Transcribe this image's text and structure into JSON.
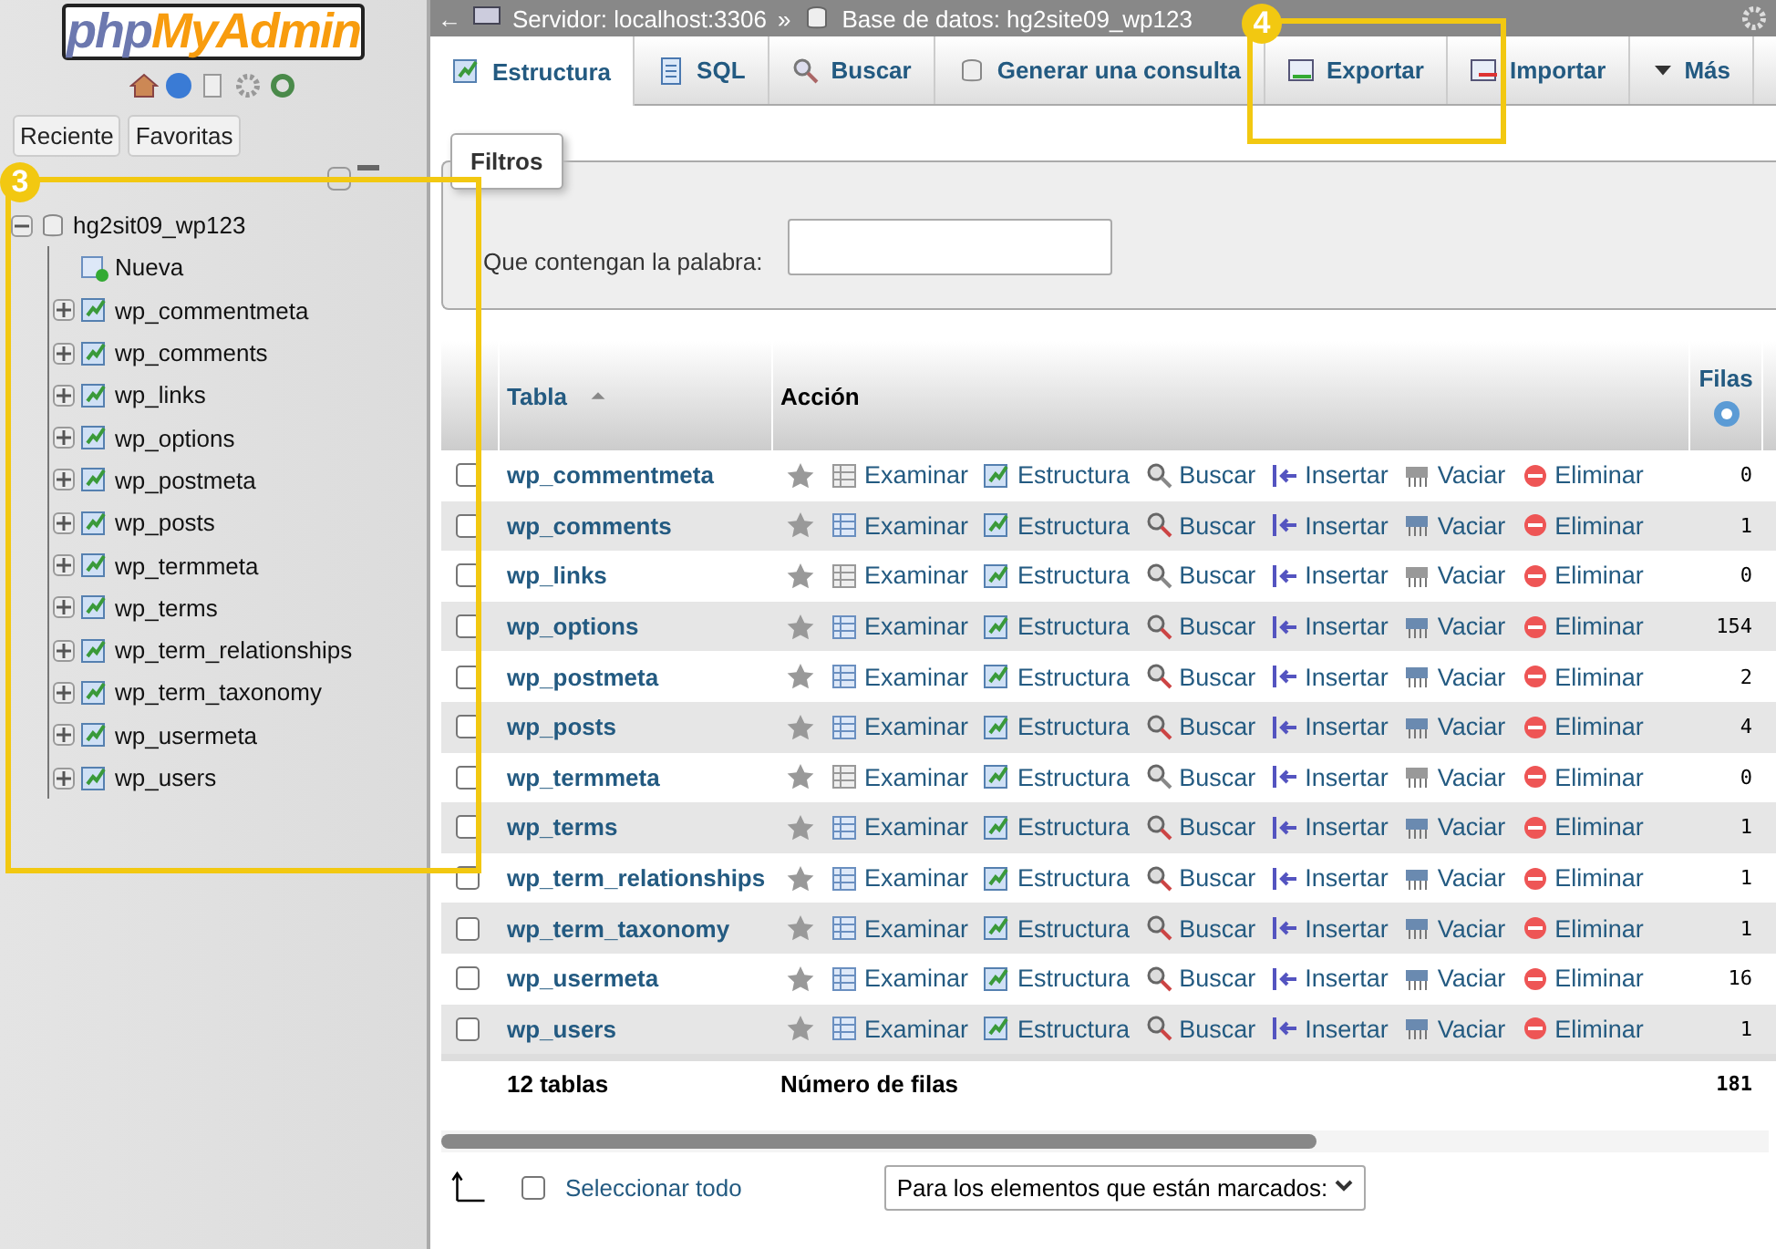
{
  "sidebar": {
    "logo": {
      "part1": "php",
      "part2": "MyAdmin"
    },
    "buttons": [
      "Reciente",
      "Favoritas"
    ],
    "tree": [
      {
        "label": "hg2sit09_wp123",
        "kind": "database",
        "expanded": true,
        "children": [
          {
            "label": "Nueva",
            "kind": "new"
          },
          {
            "label": "wp_commentmeta",
            "kind": "table",
            "expanded": false
          },
          {
            "label": "wp_comments",
            "kind": "table",
            "expanded": false
          },
          {
            "label": "wp_links",
            "kind": "table",
            "expanded": false
          },
          {
            "label": "wp_options",
            "kind": "table",
            "expanded": false
          },
          {
            "label": "wp_postmeta",
            "kind": "table",
            "expanded": false
          },
          {
            "label": "wp_posts",
            "kind": "table",
            "expanded": false
          },
          {
            "label": "wp_termmeta",
            "kind": "table",
            "expanded": false
          },
          {
            "label": "wp_terms",
            "kind": "table",
            "expanded": false
          },
          {
            "label": "wp_term_relationships",
            "kind": "table",
            "expanded": false
          },
          {
            "label": "wp_term_taxonomy",
            "kind": "table",
            "expanded": false
          },
          {
            "label": "wp_usermeta",
            "kind": "table",
            "expanded": false
          },
          {
            "label": "wp_users",
            "kind": "table",
            "expanded": false
          }
        ]
      }
    ]
  },
  "breadcrumb": {
    "back": "←",
    "server": "Servidor: localhost:3306",
    "separator": "»",
    "database": "Base de datos: hg2site09_wp123"
  },
  "tabs": [
    {
      "label": "Estructura",
      "kind": "structure",
      "selected": true
    },
    {
      "label": "SQL",
      "kind": "sql",
      "selected": false
    },
    {
      "label": "Buscar",
      "kind": "search",
      "selected": false
    },
    {
      "label": "Generar una consulta",
      "kind": "query",
      "selected": false
    },
    {
      "label": "Exportar",
      "kind": "export",
      "selected": false
    },
    {
      "label": "Importar",
      "kind": "import",
      "selected": false
    },
    {
      "label": "Más",
      "kind": "more",
      "selected": false
    }
  ],
  "filter": {
    "legend": "Filtros",
    "label": "Que contengan la palabra:"
  },
  "table": {
    "columns": [
      "Tabla",
      "Acción",
      "Filas"
    ],
    "rows": [
      {
        "name": "wp_commentmeta",
        "checked": false,
        "empty": true,
        "actions": [
          "Examinar",
          "Estructura",
          "Buscar",
          "Insertar",
          "Vaciar",
          "Eliminar"
        ],
        "rows": "0"
      },
      {
        "name": "wp_comments",
        "checked": false,
        "empty": false,
        "actions": [
          "Examinar",
          "Estructura",
          "Buscar",
          "Insertar",
          "Vaciar",
          "Eliminar"
        ],
        "rows": "1"
      },
      {
        "name": "wp_links",
        "checked": false,
        "empty": true,
        "actions": [
          "Examinar",
          "Estructura",
          "Buscar",
          "Insertar",
          "Vaciar",
          "Eliminar"
        ],
        "rows": "0"
      },
      {
        "name": "wp_options",
        "checked": false,
        "empty": false,
        "actions": [
          "Examinar",
          "Estructura",
          "Buscar",
          "Insertar",
          "Vaciar",
          "Eliminar"
        ],
        "rows": "154"
      },
      {
        "name": "wp_postmeta",
        "checked": false,
        "empty": false,
        "actions": [
          "Examinar",
          "Estructura",
          "Buscar",
          "Insertar",
          "Vaciar",
          "Eliminar"
        ],
        "rows": "2"
      },
      {
        "name": "wp_posts",
        "checked": false,
        "empty": false,
        "actions": [
          "Examinar",
          "Estructura",
          "Buscar",
          "Insertar",
          "Vaciar",
          "Eliminar"
        ],
        "rows": "4"
      },
      {
        "name": "wp_termmeta",
        "checked": false,
        "empty": true,
        "actions": [
          "Examinar",
          "Estructura",
          "Buscar",
          "Insertar",
          "Vaciar",
          "Eliminar"
        ],
        "rows": "0"
      },
      {
        "name": "wp_terms",
        "checked": false,
        "empty": false,
        "actions": [
          "Examinar",
          "Estructura",
          "Buscar",
          "Insertar",
          "Vaciar",
          "Eliminar"
        ],
        "rows": "1"
      },
      {
        "name": "wp_term_relationships",
        "checked": false,
        "empty": false,
        "actions": [
          "Examinar",
          "Estructura",
          "Buscar",
          "Insertar",
          "Vaciar",
          "Eliminar"
        ],
        "rows": "1"
      },
      {
        "name": "wp_term_taxonomy",
        "checked": false,
        "empty": false,
        "actions": [
          "Examinar",
          "Estructura",
          "Buscar",
          "Insertar",
          "Vaciar",
          "Eliminar"
        ],
        "rows": "1"
      },
      {
        "name": "wp_usermeta",
        "checked": false,
        "empty": false,
        "actions": [
          "Examinar",
          "Estructura",
          "Buscar",
          "Insertar",
          "Vaciar",
          "Eliminar"
        ],
        "rows": "16"
      },
      {
        "name": "wp_users",
        "checked": false,
        "empty": false,
        "actions": [
          "Examinar",
          "Estructura",
          "Buscar",
          "Insertar",
          "Vaciar",
          "Eliminar"
        ],
        "rows": "1"
      }
    ],
    "footer": {
      "count": "12 tablas",
      "label": "Número de filas",
      "total": "181"
    }
  },
  "bulk": {
    "select_all": "Seleccionar todo",
    "checked": false,
    "dropdown": "Para los elementos que están marcados:"
  },
  "annotations": [
    {
      "label": "3",
      "kind": "sidebar"
    },
    {
      "label": "4",
      "kind": "tabs"
    }
  ]
}
